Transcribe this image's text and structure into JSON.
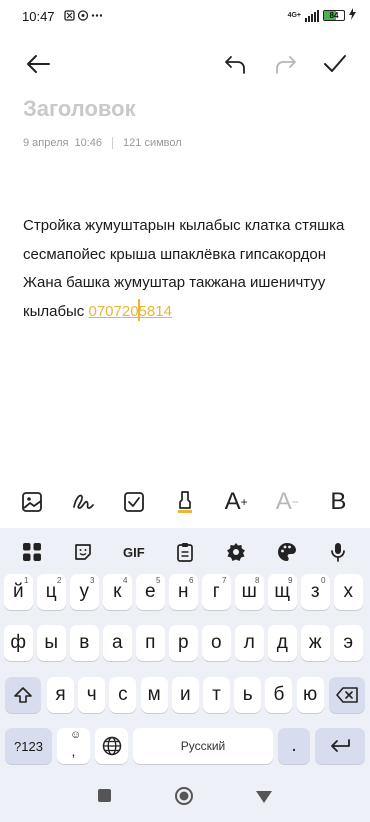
{
  "status": {
    "time": "10:47",
    "network": "4G+",
    "battery": "84"
  },
  "note": {
    "title_placeholder": "Заголовок",
    "date": "9 апреля",
    "time": "10:46",
    "char_count": "121 символ",
    "text_before": "Стройка жумуштарын кылабыс клатка стяшка сесмапойес крыша шпаклёвка гипсакордон Жана башка жумуштар такжана ишеничтуу кылабыс ",
    "phone_part1": "070720",
    "phone_part2": "5814"
  },
  "format_bar": {
    "text_increase": "A",
    "text_decrease": "A",
    "bold": "B"
  },
  "keyboard": {
    "gif_label": "GIF",
    "row1": [
      {
        "k": "й",
        "h": "1"
      },
      {
        "k": "ц",
        "h": "2"
      },
      {
        "k": "у",
        "h": "3"
      },
      {
        "k": "к",
        "h": "4"
      },
      {
        "k": "е",
        "h": "5"
      },
      {
        "k": "н",
        "h": "6"
      },
      {
        "k": "г",
        "h": "7"
      },
      {
        "k": "ш",
        "h": "8"
      },
      {
        "k": "щ",
        "h": "9"
      },
      {
        "k": "з",
        "h": "0"
      },
      {
        "k": "х",
        "h": ""
      }
    ],
    "row2": [
      "ф",
      "ы",
      "в",
      "а",
      "п",
      "р",
      "о",
      "л",
      "д",
      "ж",
      "э"
    ],
    "row3": [
      "я",
      "ч",
      "с",
      "м",
      "и",
      "т",
      "ь",
      "б",
      "ю"
    ],
    "numbers_label": "?123",
    "space_label": "Русский",
    "period": ".",
    "comma_emoji": ","
  },
  "colors": {
    "accent": "#e8b73a",
    "keyboard_bg": "#eef0f8",
    "function_key": "#d8dcef"
  }
}
